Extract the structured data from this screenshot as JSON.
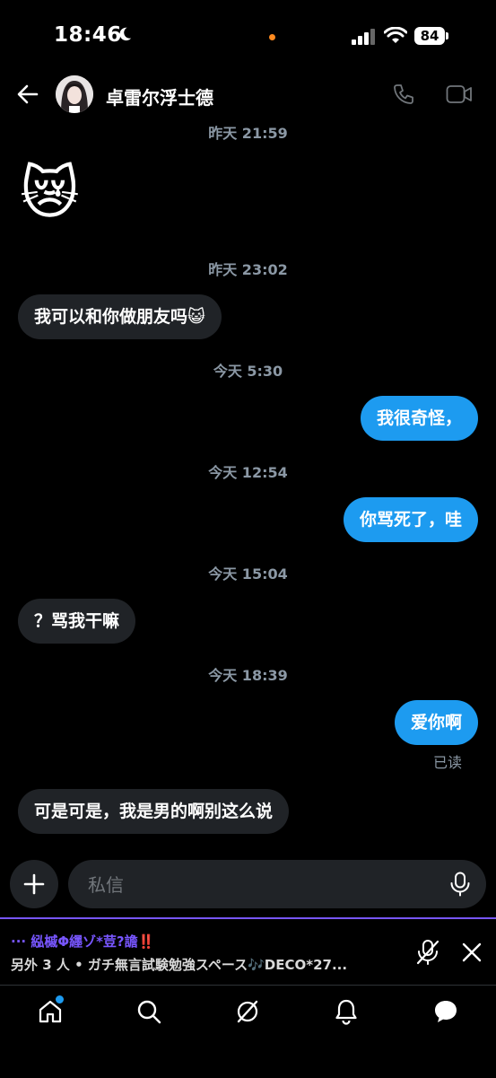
{
  "status_bar": {
    "time": "18:46",
    "battery": "84"
  },
  "header": {
    "contact_name": "卓雷尔浮士德"
  },
  "messages": [
    {
      "type": "timestamp",
      "text": "昨天 21:59"
    },
    {
      "type": "incoming",
      "text": "😿",
      "emoji_only": true
    },
    {
      "type": "timestamp",
      "text": "昨天 23:02"
    },
    {
      "type": "incoming",
      "text": "我可以和你做朋友吗😺"
    },
    {
      "type": "timestamp",
      "text": "今天 5:30"
    },
    {
      "type": "outgoing",
      "text": "我很奇怪，"
    },
    {
      "type": "timestamp",
      "text": "今天 12:54"
    },
    {
      "type": "outgoing",
      "text": "你骂死了，哇"
    },
    {
      "type": "timestamp",
      "text": "今天 15:04"
    },
    {
      "type": "incoming",
      "text": "？骂我干嘛"
    },
    {
      "type": "timestamp",
      "text": "今天 18:39"
    },
    {
      "type": "outgoing",
      "text": "爱你啊"
    },
    {
      "type": "receipt",
      "text": "已读"
    },
    {
      "type": "incoming",
      "text": "可是可是，我是男的啊别这么说"
    }
  ],
  "compose": {
    "placeholder": "私信"
  },
  "space": {
    "title": "··· 紭槭Φ纆ゾ*荳?譫‼️",
    "subtitle": "另外 3 人 • ガチ無言試験勉強スペース🎶DECO*27..."
  },
  "nav": {
    "items": [
      "home-icon",
      "search-icon",
      "grok-icon",
      "notifications-icon",
      "messages-icon"
    ],
    "has_home_badge": true
  },
  "colors": {
    "accent": "#1d9bf0",
    "bubble_in": "#202327",
    "space_purple": "#7856ff",
    "muted_text": "#8b98a5"
  }
}
